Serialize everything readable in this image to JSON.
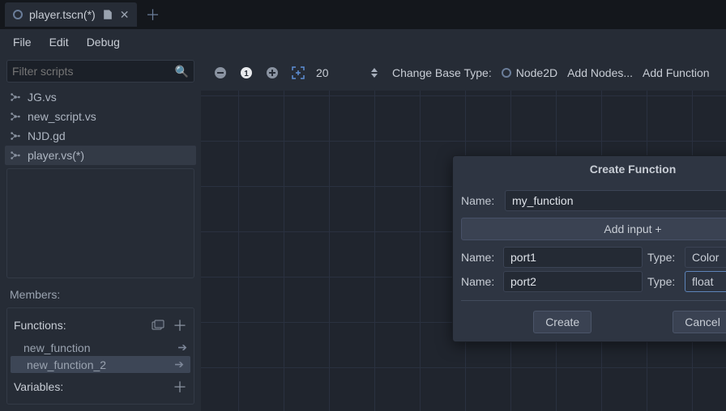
{
  "tab": {
    "title": "player.tscn(*)"
  },
  "menu": {
    "file": "File",
    "edit": "Edit",
    "debug": "Debug"
  },
  "sidebar": {
    "filter_placeholder": "Filter scripts",
    "scripts": [
      {
        "name": "JG.vs"
      },
      {
        "name": "new_script.vs"
      },
      {
        "name": "NJD.gd"
      },
      {
        "name": "player.vs(*)"
      }
    ],
    "members_label": "Members:",
    "functions_label": "Functions:",
    "variables_label": "Variables:",
    "functions": [
      {
        "name": "new_function"
      },
      {
        "name": "new_function_2"
      }
    ]
  },
  "toolbar": {
    "zoom_value": "20",
    "change_base_label": "Change Base Type:",
    "base_type": "Node2D",
    "add_nodes": "Add Nodes...",
    "add_function": "Add Function"
  },
  "dialog": {
    "title": "Create Function",
    "name_label": "Name:",
    "name_value": "my_function",
    "add_input_label": "Add input +",
    "type_label": "Type:",
    "ports": [
      {
        "name": "port1",
        "type": "Color",
        "focused": false
      },
      {
        "name": "port2",
        "type": "float",
        "focused": true
      }
    ],
    "create": "Create",
    "cancel": "Cancel"
  }
}
